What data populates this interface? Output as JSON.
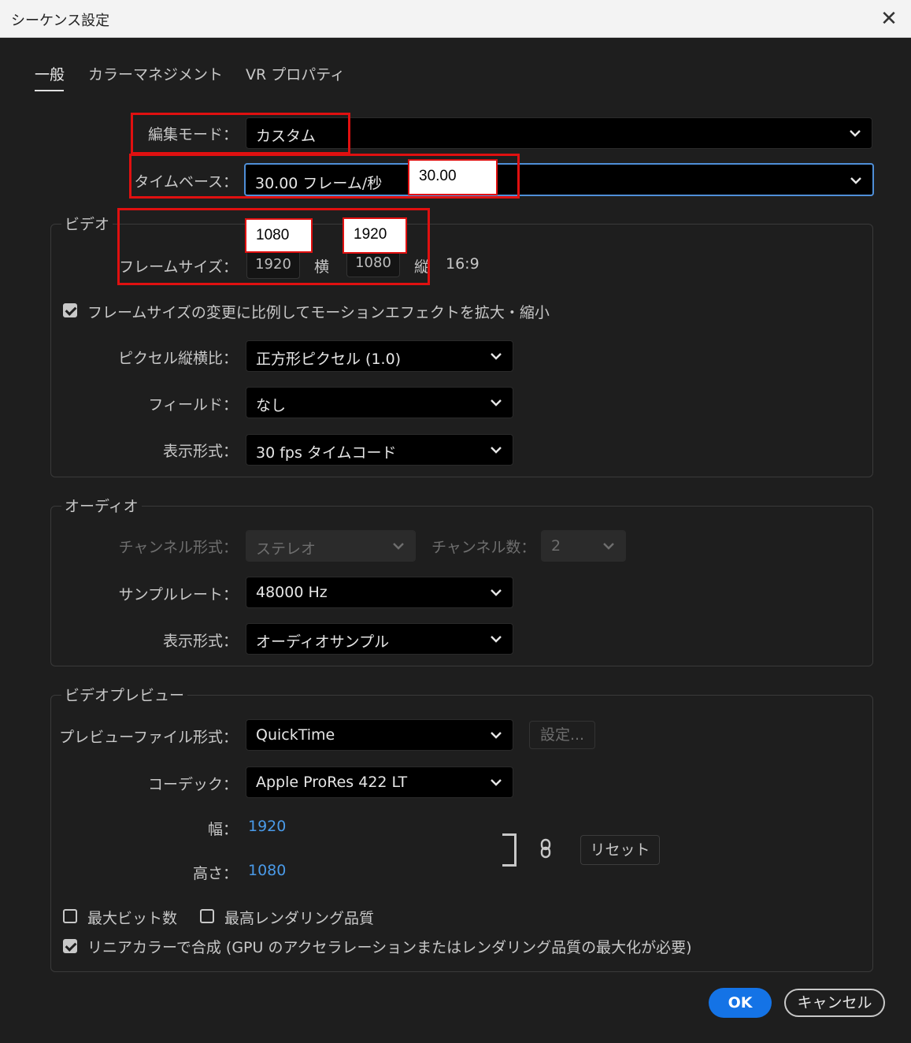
{
  "window": {
    "title": "シーケンス設定",
    "close_glyph": "✕"
  },
  "tabs": [
    "一般",
    "カラーマネジメント",
    "VR プロパティ"
  ],
  "editing_mode": {
    "label": "編集モード：",
    "value": "カスタム"
  },
  "timebase": {
    "label": "タイムベース：",
    "value": "30.00  フレーム/秒"
  },
  "video": {
    "title": "ビデオ",
    "frame_size_label": "フレームサイズ：",
    "width": "1920",
    "width_unit": "横",
    "height": "1080",
    "height_unit": "縦",
    "aspect": "16:9",
    "scale_checkbox": "フレームサイズの変更に比例してモーションエフェクトを拡大・縮小",
    "pixel_aspect_label": "ピクセル縦横比：",
    "pixel_aspect_value": "正方形ピクセル (1.0)",
    "fields_label": "フィールド：",
    "fields_value": "なし",
    "display_format_label": "表示形式：",
    "display_format_value": "30 fps タイムコード"
  },
  "audio": {
    "title": "オーディオ",
    "channel_format_label": "チャンネル形式：",
    "channel_format_value": "ステレオ",
    "channel_count_label": "チャンネル数：",
    "channel_count_value": "2",
    "sample_rate_label": "サンプルレート：",
    "sample_rate_value": "48000 Hz",
    "display_format_label": "表示形式：",
    "display_format_value": "オーディオサンプル"
  },
  "preview": {
    "title": "ビデオプレビュー",
    "file_format_label": "プレビューファイル形式：",
    "file_format_value": "QuickTime",
    "settings_button": "設定...",
    "codec_label": "コーデック：",
    "codec_value": "Apple ProRes 422 LT",
    "width_label": "幅：",
    "width_value": "1920",
    "height_label": "高さ：",
    "height_value": "1080",
    "reset_button": "リセット",
    "max_bit_depth": "最大ビット数",
    "max_render_quality": "最高レンダリング品質",
    "linear_color": "リニアカラーで合成 (GPU のアクセラレーションまたはレンダリング品質の最大化が必要)"
  },
  "annotations": {
    "timebase_note": "30.00",
    "height_note": "1080",
    "width_note": "1920",
    "highlight_color": "#e01010"
  },
  "buttons": {
    "ok": "OK",
    "cancel": "キャンセル"
  },
  "colors": {
    "accent": "#1473e6",
    "link_value": "#4a9ae8",
    "background": "#1e1e1e"
  }
}
